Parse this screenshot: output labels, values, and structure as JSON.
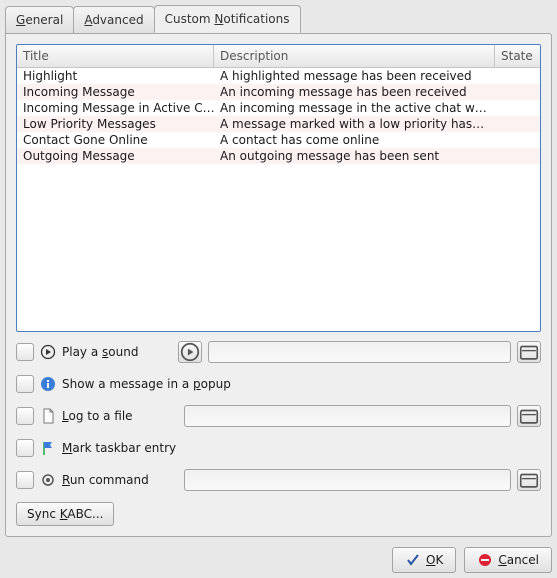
{
  "tabs": {
    "general": {
      "pre": "",
      "u": "G",
      "post": "eneral"
    },
    "advanced": {
      "pre": "",
      "u": "A",
      "post": "dvanced"
    },
    "custom": {
      "pre": "Custom ",
      "u": "N",
      "post": "otifications"
    }
  },
  "columns": {
    "title": "Title",
    "description": "Description",
    "state": "State"
  },
  "rows": [
    {
      "title": "Highlight",
      "desc": "A highlighted message has been received"
    },
    {
      "title": "Incoming Message",
      "desc": "An incoming message has been received"
    },
    {
      "title": "Incoming Message in Active Chat",
      "desc": "An incoming message in the active chat w…"
    },
    {
      "title": "Low Priority Messages",
      "desc": "A message marked with a low priority has…"
    },
    {
      "title": "Contact Gone Online",
      "desc": "A contact has come online"
    },
    {
      "title": "Outgoing Message",
      "desc": "An outgoing message has been sent"
    }
  ],
  "options": {
    "sound": {
      "pre": "Play a ",
      "u": "s",
      "post": "ound"
    },
    "popup": {
      "pre": "Show a message in a ",
      "u": "p",
      "post": "opup"
    },
    "log": {
      "pre": "",
      "u": "L",
      "post": "og to a file"
    },
    "taskbar": {
      "pre": "",
      "u": "M",
      "post": "ark taskbar entry"
    },
    "run": {
      "pre": "",
      "u": "R",
      "post": "un command"
    }
  },
  "sync": {
    "pre": "Sync ",
    "u": "K",
    "post": "ABC..."
  },
  "ok": {
    "pre": "",
    "u": "O",
    "post": "K"
  },
  "cancel": {
    "pre": "",
    "u": "C",
    "post": "ancel"
  }
}
